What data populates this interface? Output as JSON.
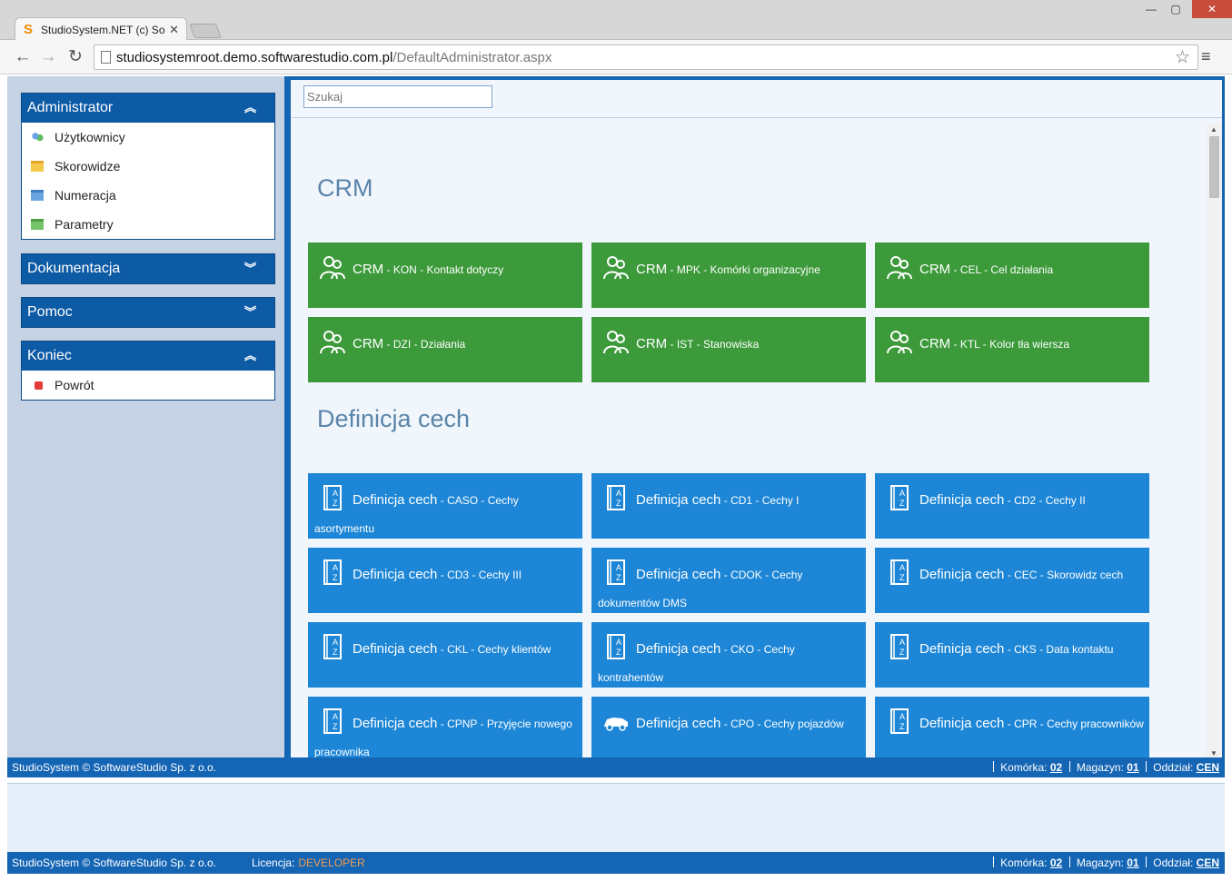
{
  "browser": {
    "tab_title": "StudioSystem.NET (c) Soft",
    "url_host": "studiosystemroot.demo.softwarestudio.com.pl",
    "url_path": "/DefaultAdministrator.aspx"
  },
  "sidebar": {
    "panels": [
      {
        "title": "Administrator",
        "items": [
          "Użytkownicy",
          "Skorowidze",
          "Numeracja",
          "Parametry"
        ]
      },
      {
        "title": "Dokumentacja"
      },
      {
        "title": "Pomoc"
      },
      {
        "title": "Koniec",
        "items": [
          "Powrót"
        ]
      }
    ]
  },
  "search": {
    "placeholder": "Szukaj"
  },
  "sections": [
    {
      "title": "CRM",
      "tiles": [
        {
          "main": "CRM",
          "code": "KON",
          "desc": "Kontakt dotyczy"
        },
        {
          "main": "CRM",
          "code": "MPK",
          "desc": "Komórki organizacyjne"
        },
        {
          "main": "CRM",
          "code": "CEL",
          "desc": "Cel działania"
        },
        {
          "main": "CRM",
          "code": "DZI",
          "desc": "Działania"
        },
        {
          "main": "CRM",
          "code": "IST",
          "desc": "Stanowiska"
        },
        {
          "main": "CRM",
          "code": "KTL",
          "desc": "Kolor tła wiersza"
        }
      ]
    },
    {
      "title": "Definicja cech",
      "tiles": [
        {
          "main": "Definicja cech",
          "code": "CASO",
          "desc": "Cechy asortymentu"
        },
        {
          "main": "Definicja cech",
          "code": "CD1",
          "desc": "Cechy I"
        },
        {
          "main": "Definicja cech",
          "code": "CD2",
          "desc": "Cechy II"
        },
        {
          "main": "Definicja cech",
          "code": "CD3",
          "desc": "Cechy III"
        },
        {
          "main": "Definicja cech",
          "code": "CDOK",
          "desc": "Cechy dokumentów DMS"
        },
        {
          "main": "Definicja cech",
          "code": "CEC",
          "desc": "Skorowidz cech"
        },
        {
          "main": "Definicja cech",
          "code": "CKL",
          "desc": "Cechy klientów"
        },
        {
          "main": "Definicja cech",
          "code": "CKO",
          "desc": "Cechy kontrahentów"
        },
        {
          "main": "Definicja cech",
          "code": "CKS",
          "desc": "Data kontaktu"
        },
        {
          "main": "Definicja cech",
          "code": "CPNP",
          "desc": "Przyjęcie nowego pracownika"
        },
        {
          "main": "Definicja cech",
          "code": "CPO",
          "desc": "Cechy pojazdów"
        },
        {
          "main": "Definicja cech",
          "code": "CPR",
          "desc": "Cechy pracowników"
        }
      ]
    }
  ],
  "status": {
    "copyright": "StudioSystem © SoftwareStudio Sp. z o.o.",
    "komorka_label": "Komórka:",
    "komorka_value": "02",
    "magazyn_label": "Magazyn:",
    "magazyn_value": "01",
    "oddzial_label": "Oddział:",
    "oddzial_value": "CEN"
  },
  "bottom": {
    "copyright": "StudioSystem © SoftwareStudio Sp. z o.o.",
    "license_label": "Licencja:",
    "license_value": "DEVELOPER"
  },
  "colors": {
    "green_tile": "#3c9a3a",
    "blue_tile": "#1d86d6",
    "header_blue": "#1565b5",
    "license": "#f39c4a"
  },
  "icons": {
    "crm_tile": "people-icon",
    "def_tile": "az-book-icon",
    "cpo_tile": "car-icon"
  }
}
